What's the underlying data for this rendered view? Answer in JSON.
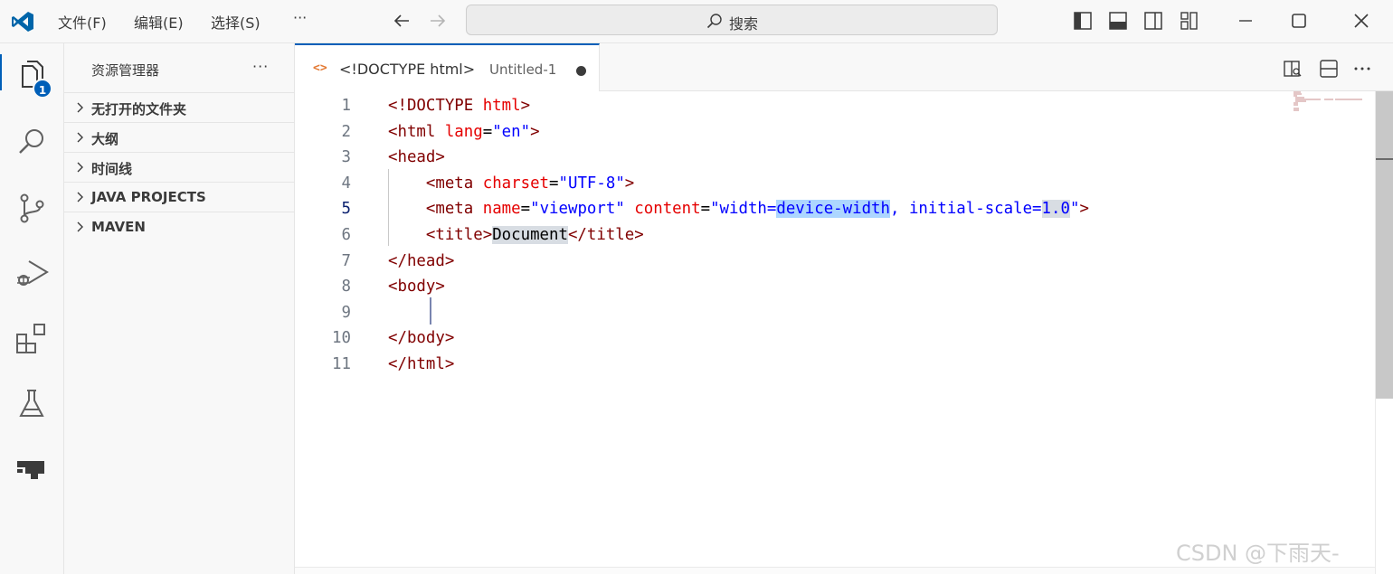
{
  "titlebar": {
    "menu": [
      "文件(F)",
      "编辑(E)",
      "选择(S)",
      "···"
    ],
    "search_label": "搜索"
  },
  "activity": {
    "explorer_badge": "1",
    "items": [
      "explorer-icon",
      "search-icon",
      "source-control-icon",
      "run-debug-icon",
      "extensions-icon",
      "testing-icon",
      "remote-explorer-icon"
    ]
  },
  "sidebar": {
    "title": "资源管理器",
    "more": "···",
    "sections": [
      "无打开的文件夹",
      "大纲",
      "时间线",
      "JAVA PROJECTS",
      "MAVEN"
    ]
  },
  "tab": {
    "icon": "<>",
    "name": "<!DOCTYPE html>",
    "description": "Untitled-1"
  },
  "editor": {
    "current_line": 5,
    "line_numbers": [
      "1",
      "2",
      "3",
      "4",
      "5",
      "6",
      "7",
      "8",
      "9",
      "10",
      "11"
    ],
    "lines": [
      [
        [
          "<!DOCTYPE ",
          "t"
        ],
        [
          "html",
          "a"
        ],
        [
          ">",
          "t"
        ]
      ],
      [
        [
          "<html ",
          "t"
        ],
        [
          "lang",
          "a"
        ],
        [
          "=",
          "x"
        ],
        [
          "\"en\"",
          "s"
        ],
        [
          ">",
          "t"
        ]
      ],
      [
        [
          "<head>",
          "t"
        ]
      ],
      [
        [
          "    ",
          "x"
        ],
        [
          "<meta ",
          "t"
        ],
        [
          "charset",
          "a"
        ],
        [
          "=",
          "x"
        ],
        [
          "\"UTF-8\"",
          "s"
        ],
        [
          ">",
          "t"
        ]
      ],
      [
        [
          "    ",
          "x"
        ],
        [
          "<meta ",
          "t"
        ],
        [
          "name",
          "a"
        ],
        [
          "=",
          "x"
        ],
        [
          "\"viewport\"",
          "s"
        ],
        [
          " ",
          "x"
        ],
        [
          "content",
          "a"
        ],
        [
          "=",
          "x"
        ],
        [
          "\"width=",
          "s"
        ],
        [
          "device-width",
          "s",
          "sel"
        ],
        [
          ", initial-scale=",
          "s"
        ],
        [
          "1.0",
          "s",
          "hl"
        ],
        [
          "\"",
          "s"
        ],
        [
          ">",
          "t"
        ]
      ],
      [
        [
          "    ",
          "x"
        ],
        [
          "<title>",
          "t"
        ],
        [
          "Document",
          "x",
          "hl"
        ],
        [
          "</title>",
          "t"
        ]
      ],
      [
        [
          "</head>",
          "t"
        ]
      ],
      [
        [
          "<body>",
          "t"
        ]
      ],
      [
        [
          "",
          "x"
        ]
      ],
      [
        [
          "</body>",
          "t"
        ]
      ],
      [
        [
          "</html>",
          "t"
        ]
      ]
    ]
  },
  "watermark": "CSDN @下雨天-",
  "colors": {
    "accent": "#005fb8",
    "tag": "#800000",
    "attr": "#e50000",
    "string": "#0000ff",
    "selection": "#add6ff"
  }
}
